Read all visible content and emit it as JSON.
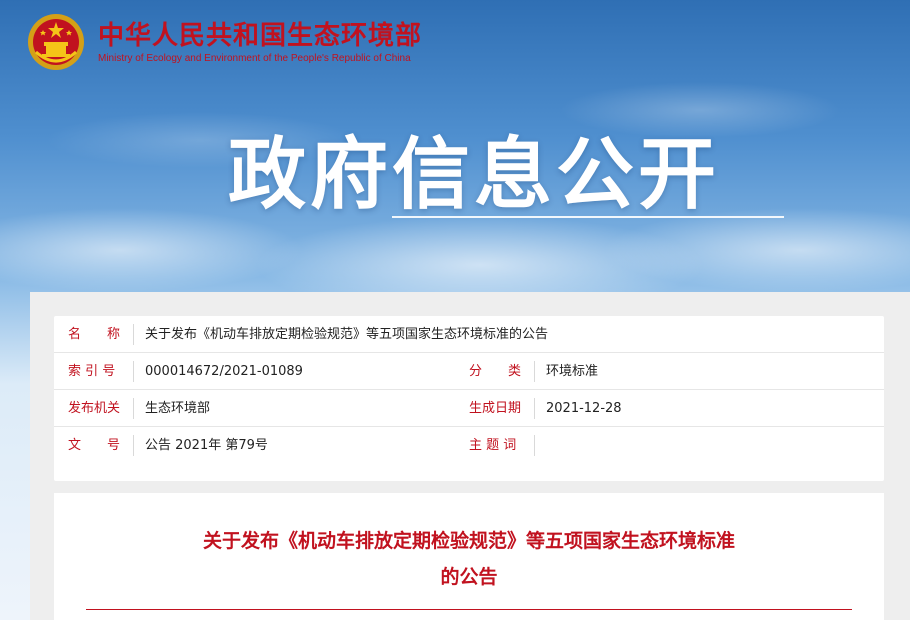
{
  "header": {
    "name_cn": "中华人民共和国生态环境部",
    "name_en": "Ministry of Ecology and Environment of the People's Republic of China",
    "emblem_icon": "national-emblem-icon"
  },
  "banner": {
    "title": "政府信息公开"
  },
  "meta": {
    "name_label": "名　　称",
    "name_value": "关于发布《机动车排放定期检验规范》等五项国家生态环境标准的公告",
    "index_label": "索 引 号",
    "index_value": "000014672/2021-01089",
    "category_label": "分　　类",
    "category_value": "环境标准",
    "issuer_label": "发布机关",
    "issuer_value": "生态环境部",
    "date_label": "生成日期",
    "date_value": "2021-12-28",
    "doc_label": "文　　号",
    "doc_value": "公告 2021年 第79号",
    "subject_label": "主 题 词",
    "subject_value": ""
  },
  "article": {
    "title_line1": "关于发布《机动车排放定期检验规范》等五项国家生态环境标准",
    "title_line2": "的公告"
  },
  "colors": {
    "accent": "#c1121f",
    "sky_top": "#2f6fb4",
    "panel_bg": "#eeeeee"
  }
}
